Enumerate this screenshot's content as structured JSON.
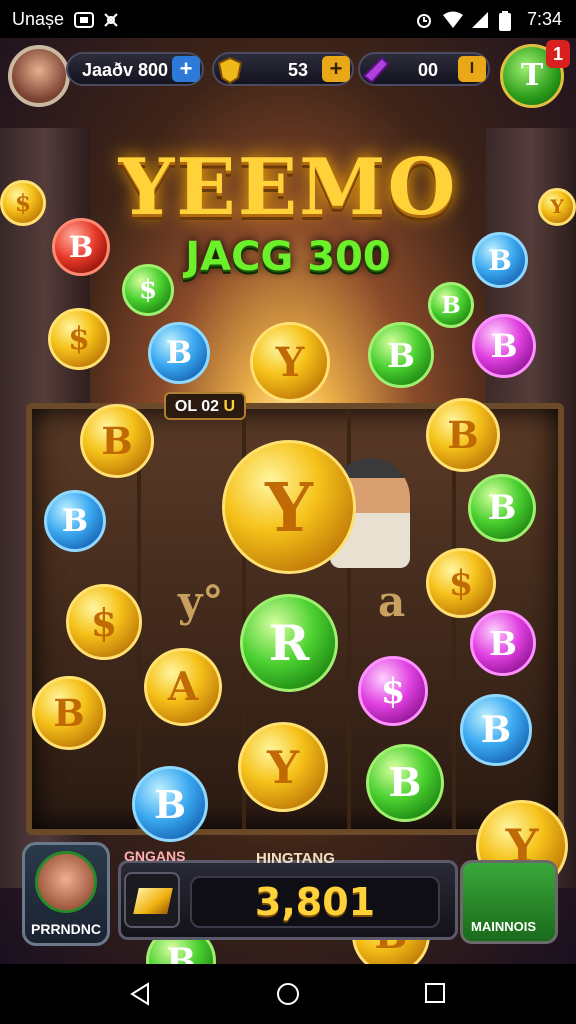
{
  "status_bar": {
    "carrier": "Unașe",
    "time": "7:34"
  },
  "top_bar": {
    "player_name": "Jaaðv 800",
    "gold_count": "53",
    "gem_count": "00",
    "notification_badge": "1",
    "badge_letter": "T"
  },
  "title": {
    "main": "YEEMO",
    "sub": "JACG 300"
  },
  "reels": {
    "timer": "OL 02",
    "timer_suffix": "U",
    "symbols": [
      "y°",
      "a"
    ]
  },
  "coins": [
    {
      "letter": "$",
      "kind": "gold"
    },
    {
      "letter": "B",
      "kind": "red"
    },
    {
      "letter": "$",
      "kind": "green"
    },
    {
      "letter": "B",
      "kind": "blue"
    },
    {
      "letter": "Y",
      "kind": "gold"
    },
    {
      "letter": "B",
      "kind": "green"
    },
    {
      "letter": "B",
      "kind": "blue"
    },
    {
      "letter": "B",
      "kind": "green"
    },
    {
      "letter": "B",
      "kind": "pink"
    },
    {
      "letter": "$",
      "kind": "gold"
    },
    {
      "letter": "Y",
      "kind": "gold"
    },
    {
      "letter": "B",
      "kind": "gold"
    },
    {
      "letter": "B",
      "kind": "blue"
    },
    {
      "letter": "B",
      "kind": "gold"
    },
    {
      "letter": "Y",
      "kind": "gold"
    },
    {
      "letter": "B",
      "kind": "green"
    },
    {
      "letter": "$",
      "kind": "gold"
    },
    {
      "letter": "R",
      "kind": "green"
    },
    {
      "letter": "$",
      "kind": "pink"
    },
    {
      "letter": "B",
      "kind": "pink"
    },
    {
      "letter": "$",
      "kind": "gold"
    },
    {
      "letter": "A",
      "kind": "gold"
    },
    {
      "letter": "B",
      "kind": "gold"
    },
    {
      "letter": "B",
      "kind": "blue"
    },
    {
      "letter": "Y",
      "kind": "gold"
    },
    {
      "letter": "B",
      "kind": "green"
    },
    {
      "letter": "B",
      "kind": "blue"
    },
    {
      "letter": "Y",
      "kind": "gold"
    },
    {
      "letter": "B",
      "kind": "gold"
    },
    {
      "letter": "B",
      "kind": "green"
    }
  ],
  "bottom_bar": {
    "player_label": "PRRNDNC",
    "gains_label": "GNGANS",
    "winnings_label": "HINGTANG",
    "winnings_value": "3,801",
    "button_label": "MAINNOIS"
  },
  "colors": {
    "gold": "#ffd23a",
    "green_text": "#6cf02a",
    "blue_plus": "#2e7ad8",
    "gold_plus": "#e8a818"
  }
}
